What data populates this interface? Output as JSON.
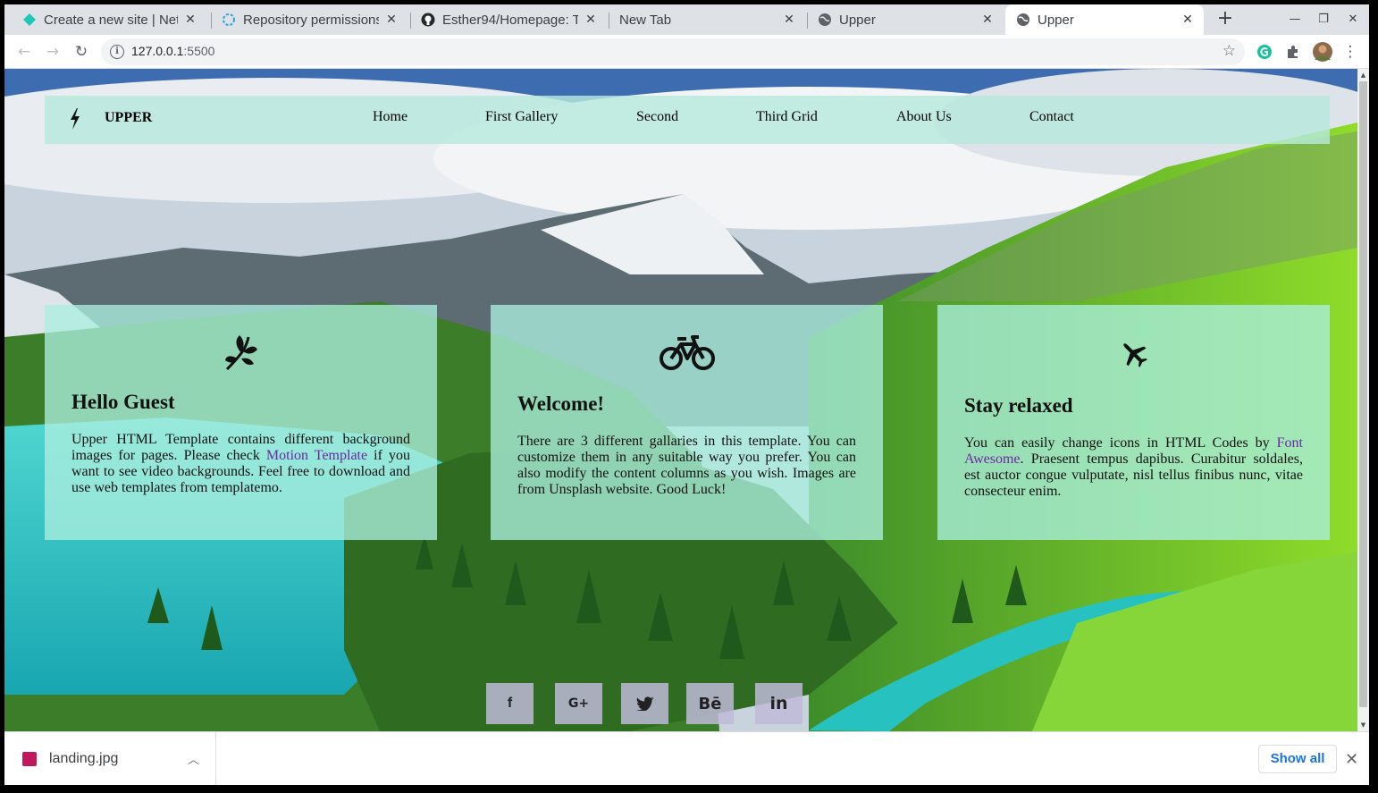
{
  "browser": {
    "tabs": [
      {
        "title": "Create a new site | Netlify",
        "favicon": "netlify-icon",
        "active": false
      },
      {
        "title": "Repository permissions",
        "favicon": "netlify-icon",
        "active": false
      },
      {
        "title": "Esther94/Homepage: T",
        "favicon": "github-icon",
        "active": false
      },
      {
        "title": "New Tab",
        "favicon": "none",
        "active": false
      },
      {
        "title": "Upper",
        "favicon": "globe-icon",
        "active": false
      },
      {
        "title": "Upper",
        "favicon": "globe-icon",
        "active": true
      }
    ],
    "url_host": "127.0.0.1",
    "url_port": ":5500"
  },
  "site": {
    "brand": "UPPER",
    "nav": [
      "Home",
      "First Gallery",
      "Second",
      "Third Grid",
      "About Us",
      "Contact"
    ],
    "cards": [
      {
        "icon": "leaf-icon",
        "title": "Hello Guest",
        "text_before": "Upper HTML Template contains different background images for pages. Please check ",
        "link": "Motion Template",
        "text_after": " if you want to see video backgrounds. Feel free to download and use web templates from templatemo."
      },
      {
        "icon": "bicycle-icon",
        "title": "Welcome!",
        "text_before": "There are 3 different gallaries in this template. You can customize them in any suitable way you prefer. You can also modify the content columns as you wish. Images are from Unsplash website. Good Luck!",
        "link": "",
        "text_after": ""
      },
      {
        "icon": "plane-icon",
        "title": "Stay relaxed",
        "text_before": "You can easily change icons in HTML Codes by ",
        "link": "Font Awesome",
        "text_after": ". Praesent tempus dapibus. Curabitur soldales, est auctor congue vulputate, nisl tellus finibus nunc, vitae consecteur enim."
      }
    ],
    "social": [
      {
        "name": "facebook-icon",
        "glyph": "f"
      },
      {
        "name": "google-plus-icon",
        "glyph": "G+"
      },
      {
        "name": "twitter-icon",
        "glyph": ""
      },
      {
        "name": "behance-icon",
        "glyph": "Bē"
      },
      {
        "name": "linkedin-icon",
        "glyph": "in"
      }
    ]
  },
  "downloads": {
    "file": "landing.jpg",
    "show_all": "Show all"
  },
  "colors": {
    "nav_bg": "#b7e9dd",
    "card_bg": "#aaeede",
    "link": "#6b2aa0",
    "social_bg": "#bebad7",
    "show_all": "#1a73e8"
  }
}
